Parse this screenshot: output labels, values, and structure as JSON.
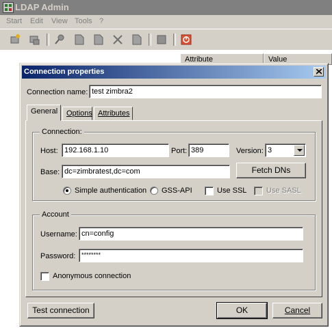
{
  "main_window": {
    "title": "LDAP Admin",
    "menu": [
      "Start",
      "Edit",
      "View",
      "Tools",
      "?"
    ],
    "toolbar_icons": [
      "connect-icon",
      "disconnect-icon",
      "search-icon",
      "new-entry-icon",
      "edit-entry-icon",
      "delete-icon",
      "properties-icon",
      "schema-icon",
      "exit-icon"
    ],
    "columns": [
      "Attribute",
      "Value"
    ]
  },
  "dialog": {
    "title": "Connection properties",
    "connection_name_label": "Connection name:",
    "connection_name_value": "test zimbra2",
    "tabs": [
      {
        "label": "General",
        "active": true
      },
      {
        "label": "Options",
        "active": false
      },
      {
        "label": "Attributes",
        "active": false
      }
    ],
    "connection_group": {
      "title": "Connection:",
      "host_label": "Host:",
      "host_value": "192.168.1.10",
      "port_label": "Port:",
      "port_value": "389",
      "version_label": "Version:",
      "version_value": "3",
      "base_label": "Base:",
      "base_value": "dc=zimbratest,dc=com",
      "fetch_dns_label": "Fetch DNs",
      "simple_auth_label": "Simple authentication",
      "simple_auth_selected": true,
      "gss_api_label": "GSS-API",
      "gss_api_selected": false,
      "use_ssl_label": "Use SSL",
      "use_ssl_checked": false,
      "use_sasl_label": "Use SASL",
      "use_sasl_checked": false,
      "use_sasl_enabled": false
    },
    "account_group": {
      "title": "Account",
      "username_label": "Username:",
      "username_value": "cn=config",
      "password_label": "Password:",
      "password_value": "********",
      "anonymous_label": "Anonymous connection",
      "anonymous_checked": false
    },
    "buttons": {
      "test_connection": "Test connection",
      "ok": "OK",
      "cancel": "Cancel"
    }
  }
}
